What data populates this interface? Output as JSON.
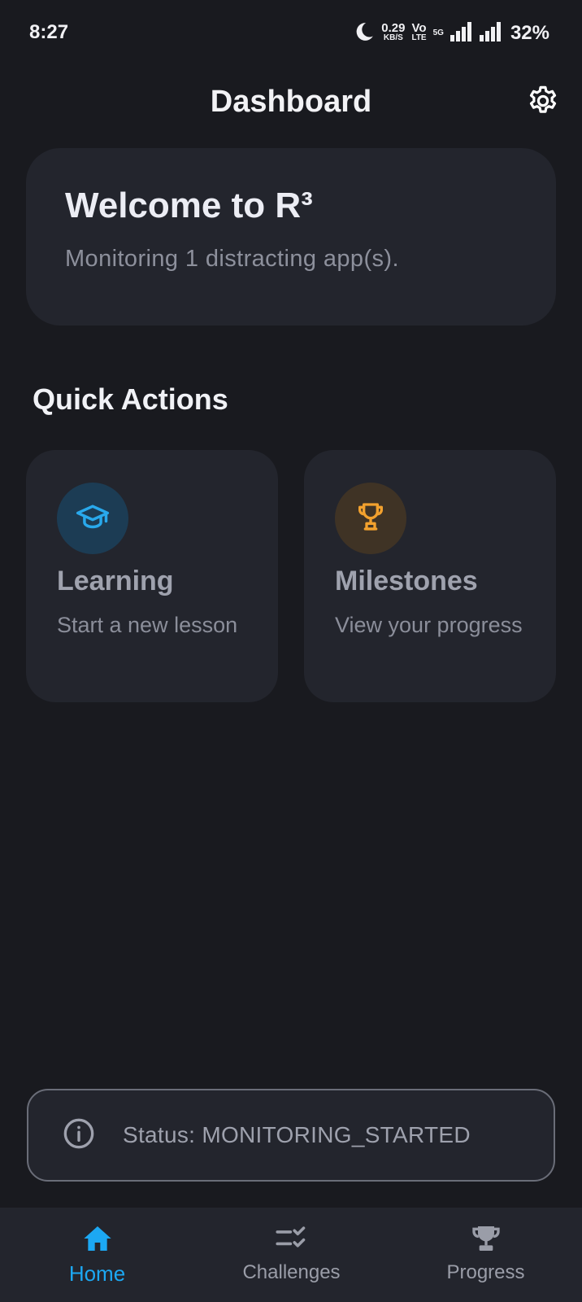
{
  "statusbar": {
    "time": "8:27",
    "speed_value": "0.29",
    "speed_unit": "KB/S",
    "volte_top": "Vo",
    "volte_bottom": "LTE",
    "network": "5G",
    "battery": "32%",
    "icons": [
      "moon-icon",
      "signal-icon",
      "signal-icon"
    ]
  },
  "appbar": {
    "title": "Dashboard",
    "settings_icon": "gear-icon"
  },
  "welcome": {
    "title": "Welcome to R³",
    "subtitle": "Monitoring 1 distracting app(s)."
  },
  "quick_actions": {
    "title": "Quick Actions",
    "items": [
      {
        "icon": "graduation-cap-icon",
        "title": "Learning",
        "subtitle": "Start a new lesson",
        "accent": "#29a9ec"
      },
      {
        "icon": "trophy-icon",
        "title": "Milestones",
        "subtitle": "View your progress",
        "accent": "#f2a12e"
      }
    ]
  },
  "status": {
    "icon": "info-icon",
    "text": "Status: MONITORING_STARTED"
  },
  "bottom_nav": {
    "items": [
      {
        "label": "Home",
        "icon": "home-icon",
        "active": true
      },
      {
        "label": "Challenges",
        "icon": "checklist-icon",
        "active": false
      },
      {
        "label": "Progress",
        "icon": "trophy-icon",
        "active": false
      }
    ]
  },
  "colors": {
    "background": "#191a1f",
    "card": "#23252d",
    "accent_active": "#1ca8f3",
    "text_muted": "#8d909c"
  }
}
